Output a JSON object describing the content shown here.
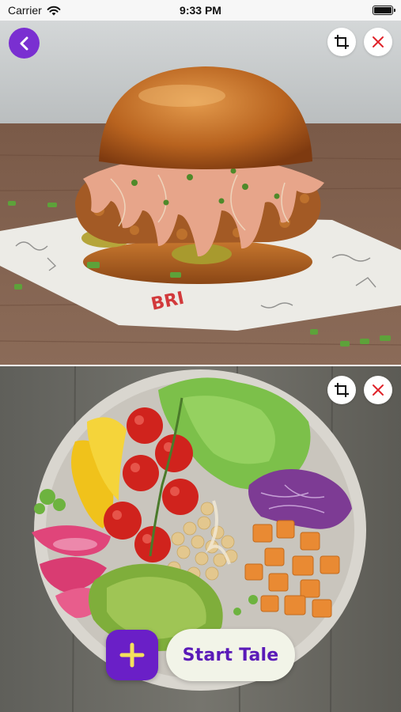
{
  "status_bar": {
    "carrier": "Carrier",
    "time": "9:33 PM"
  },
  "photos": [
    {
      "subject": "burger",
      "icons": [
        "crop-icon",
        "close-icon"
      ]
    },
    {
      "subject": "salad-bowl",
      "icons": [
        "crop-icon",
        "close-icon"
      ]
    }
  ],
  "actions": {
    "add_symbol": "+",
    "start_label": "Start Tale"
  },
  "colors": {
    "accent_purple": "#6a1fc7",
    "back_button": "#7a2fd1",
    "close_red": "#e0242b",
    "start_button_bg": "#f2f4e8"
  }
}
